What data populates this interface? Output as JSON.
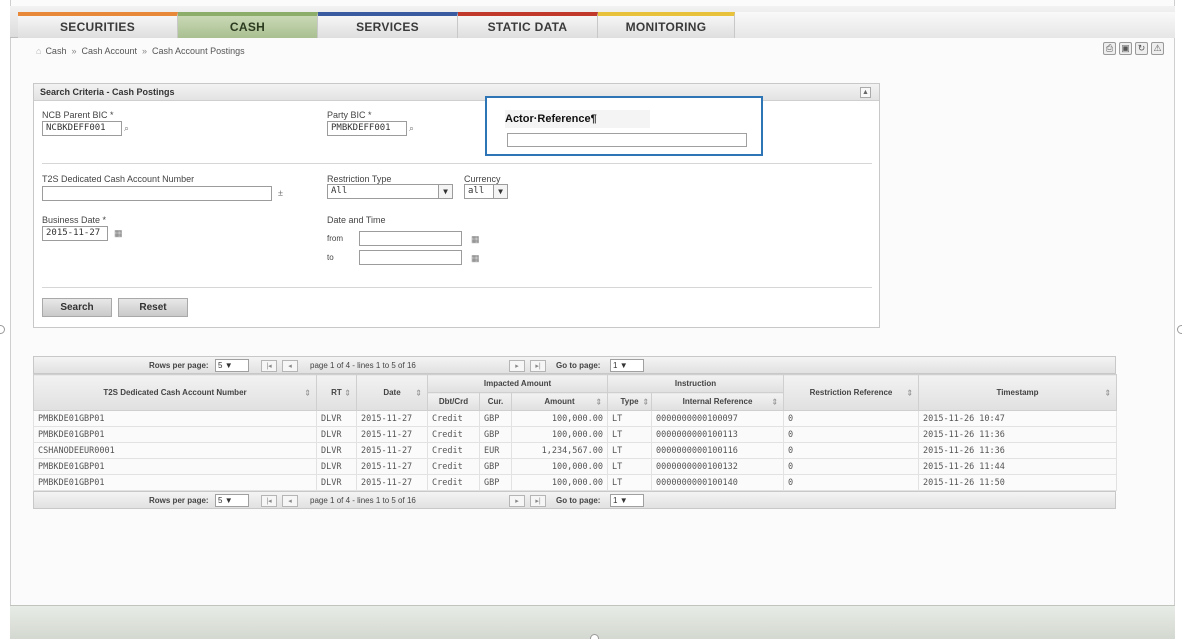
{
  "tabs": [
    {
      "label": "SECURITIES",
      "color": "#e8893a"
    },
    {
      "label": "CASH",
      "color": "#8dae6b",
      "active": true
    },
    {
      "label": "SERVICES",
      "color": "#3a5ba0"
    },
    {
      "label": "STATIC DATA",
      "color": "#c0392b"
    },
    {
      "label": "MONITORING",
      "color": "#e8c23a"
    }
  ],
  "breadcrumb": [
    "Cash",
    "Cash Account",
    "Cash Account Postings"
  ],
  "search": {
    "title": "Search Criteria - Cash Postings",
    "ncb_parent_bic_label": "NCB Parent BIC *",
    "ncb_parent_bic_value": "NCBKDEFF001",
    "party_bic_label": "Party BIC *",
    "party_bic_value": "PMBKDEFF001",
    "actor_reference_label": "Actor·Reference¶",
    "actor_reference_value": "",
    "account_number_label": "T2S Dedicated Cash Account Number",
    "account_number_value": "",
    "restriction_type_label": "Restriction Type",
    "restriction_type_value": "All",
    "currency_label": "Currency",
    "currency_value": "all",
    "business_date_label": "Business Date *",
    "business_date_value": "2015-11-27",
    "date_time_label": "Date and Time",
    "from_label": "from",
    "to_label": "to",
    "search_button": "Search",
    "reset_button": "Reset"
  },
  "pager": {
    "rows_per_page_label": "Rows per page:",
    "rows_per_page_value": "5",
    "page_info": "page 1 of 4 - lines 1 to 5 of 16",
    "go_to_page_label": "Go to page:",
    "go_to_page_value": "1"
  },
  "table": {
    "headers": {
      "account": "T2S Dedicated Cash Account Number",
      "rt": "RT",
      "date": "Date",
      "impacted_amount": "Impacted Amount",
      "dbtcrd": "Dbt/Crd",
      "cur": "Cur.",
      "amount": "Amount",
      "instruction": "Instruction",
      "type": "Type",
      "internal_reference": "Internal Reference",
      "restriction_reference": "Restriction Reference",
      "timestamp": "Timestamp"
    },
    "rows": [
      [
        "PMBKDE01GBP01",
        "DLVR",
        "2015-11-27",
        "Credit",
        "GBP",
        "100,000.00",
        "LT",
        "0000000000100097",
        "0",
        "2015-11-26 10:47"
      ],
      [
        "PMBKDE01GBP01",
        "DLVR",
        "2015-11-27",
        "Credit",
        "GBP",
        "100,000.00",
        "LT",
        "0000000000100113",
        "0",
        "2015-11-26 11:36"
      ],
      [
        "CSHANODEEUR0001",
        "DLVR",
        "2015-11-27",
        "Credit",
        "EUR",
        "1,234,567.00",
        "LT",
        "0000000000100116",
        "0",
        "2015-11-26 11:36"
      ],
      [
        "PMBKDE01GBP01",
        "DLVR",
        "2015-11-27",
        "Credit",
        "GBP",
        "100,000.00",
        "LT",
        "0000000000100132",
        "0",
        "2015-11-26 11:44"
      ],
      [
        "PMBKDE01GBP01",
        "DLVR",
        "2015-11-27",
        "Credit",
        "GBP",
        "100,000.00",
        "LT",
        "0000000000100140",
        "0",
        "2015-11-26 11:50"
      ]
    ]
  },
  "colors": {
    "active_tab": "#a9bf91",
    "callout_border": "#2e75b6"
  }
}
